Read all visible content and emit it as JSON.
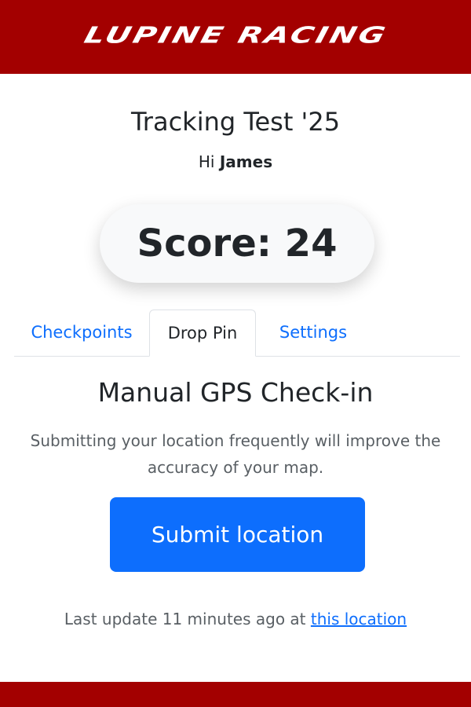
{
  "header": {
    "logo_text": "LUPINE RACING"
  },
  "event": {
    "title": "Tracking Test '25",
    "greeting_prefix": "Hi",
    "user_name": "James"
  },
  "score": {
    "label": "Score: 24"
  },
  "tabs": [
    {
      "label": "Checkpoints",
      "active": false
    },
    {
      "label": "Drop Pin",
      "active": true
    },
    {
      "label": "Settings",
      "active": false
    }
  ],
  "drop_pin": {
    "heading": "Manual GPS Check-in",
    "description": "Submitting your location frequently will improve the accuracy of your map.",
    "submit_label": "Submit location",
    "last_update_prefix": "Last update 11 minutes ago at",
    "location_link_text": "this location"
  },
  "colors": {
    "brand": "#a30000",
    "primary": "#0d6efd"
  }
}
